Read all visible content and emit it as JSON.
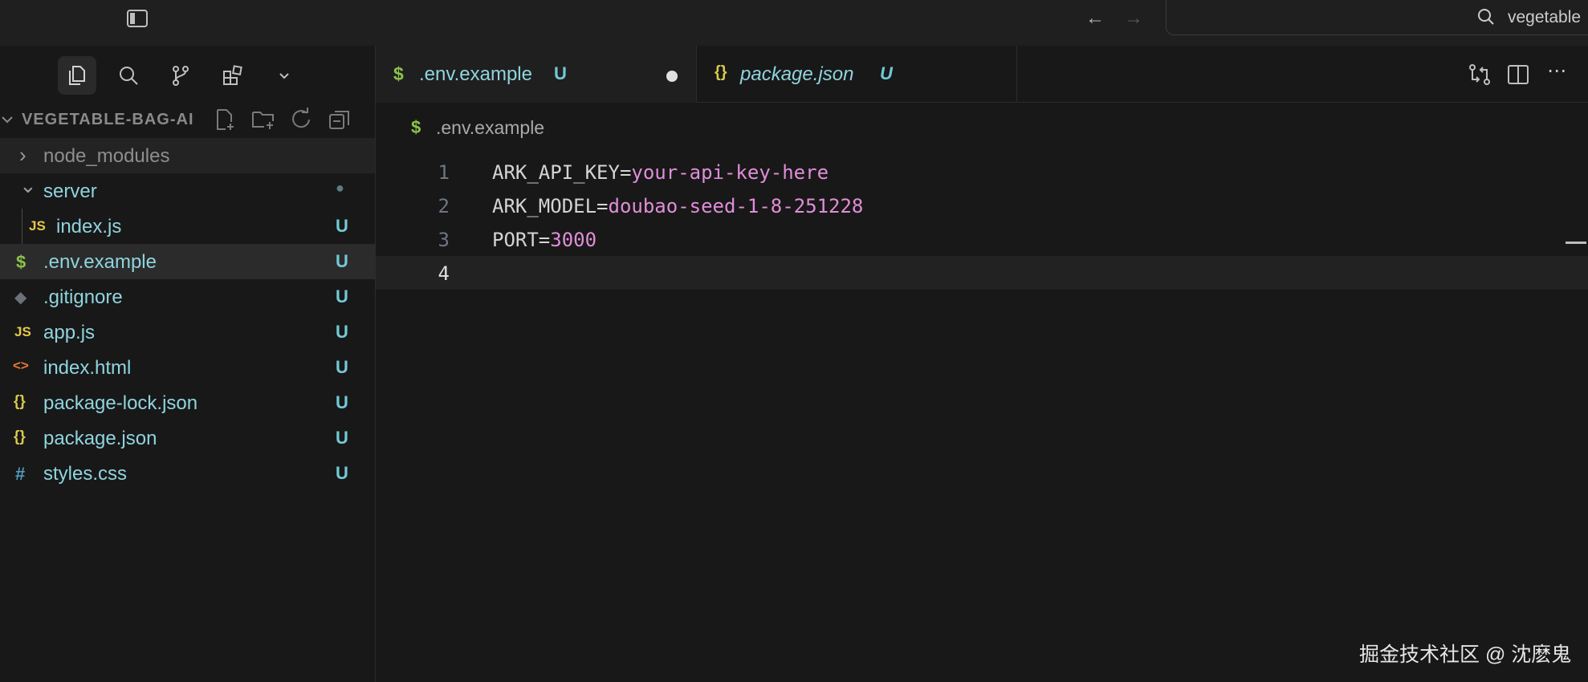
{
  "titlebar": {
    "search_text": "vegetable",
    "icons": [
      "layout-sidebar-icon",
      "arrow-left-icon",
      "arrow-right-icon",
      "search-icon"
    ]
  },
  "activity_bar": {
    "items": [
      "explorer-icon",
      "search-icon",
      "source-control-icon",
      "extensions-icon",
      "chevron-down-icon"
    ]
  },
  "explorer": {
    "project_title": "VEGETABLE-BAG-AI",
    "toolbar_icons": [
      "new-file-icon",
      "new-folder-icon",
      "refresh-icon",
      "collapse-all-icon"
    ],
    "tree": [
      {
        "label": "node_modules",
        "icon": "›",
        "badge": ""
      },
      {
        "label": "server",
        "icon": "⌄",
        "badge": "●"
      },
      {
        "label": "index.js",
        "icon": "JS",
        "badge": "U"
      },
      {
        "label": ".env.example",
        "icon": "$",
        "badge": "U"
      },
      {
        "label": ".gitignore",
        "icon": "◆",
        "badge": "U"
      },
      {
        "label": "app.js",
        "icon": "JS",
        "badge": "U"
      },
      {
        "label": "index.html",
        "icon": "<>",
        "badge": "U"
      },
      {
        "label": "package-lock.json",
        "icon": "{}",
        "badge": "U"
      },
      {
        "label": "package.json",
        "icon": "{}",
        "badge": "U"
      },
      {
        "label": "styles.css",
        "icon": "#",
        "badge": "U"
      }
    ]
  },
  "tabs": [
    {
      "label": ".env.example",
      "icon": "$",
      "badge": "U",
      "dirty": true
    },
    {
      "label": "package.json",
      "icon": "{}",
      "badge": "U",
      "dirty": false
    }
  ],
  "editor_actions": [
    "compare-changes-icon",
    "split-editor-icon",
    "more-actions-icon"
  ],
  "breadcrumb": {
    "icon": "$",
    "text": ".env.example"
  },
  "code": [
    {
      "number": "1",
      "key": "ARK_API_KEY=",
      "value": "your-api-key-here"
    },
    {
      "number": "2",
      "key": "ARK_MODEL=",
      "value": "doubao-seed-1-8-251228"
    },
    {
      "number": "3",
      "key": "PORT=",
      "value": "3000"
    },
    {
      "number": "4",
      "key": "",
      "value": ""
    }
  ],
  "watermark": "掘金技术社区 @ 沈麽鬼",
  "colors": {
    "background": "#181818",
    "accent_untracked": "#73c9d6",
    "env_value": "#e08ed8",
    "env_icon": "#8bc34a",
    "js_icon": "#e6c84a",
    "json_icon": "#d7c94b",
    "html_icon": "#e37933",
    "css_icon": "#519aba"
  }
}
